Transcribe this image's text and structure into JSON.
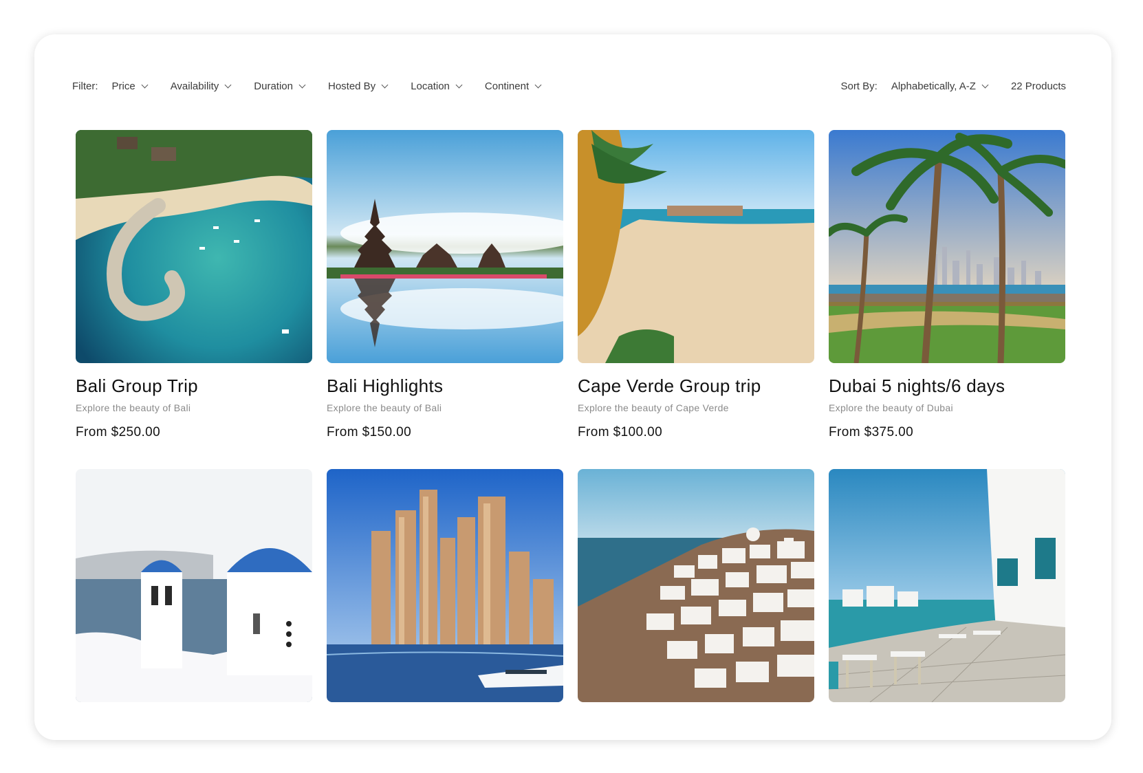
{
  "filter": {
    "label": "Filter:",
    "items": [
      "Price",
      "Availability",
      "Duration",
      "Hosted By",
      "Location",
      "Continent"
    ]
  },
  "sort": {
    "label": "Sort By:",
    "value": "Alphabetically, A-Z",
    "count": "22 Products"
  },
  "products": [
    {
      "title": "Bali Group Trip",
      "subtitle": "Explore the beauty of Bali",
      "price": "From $250.00",
      "image": "aerial-beach-lagoon"
    },
    {
      "title": "Bali Highlights",
      "subtitle": "Explore the beauty of Bali",
      "price": "From $150.00",
      "image": "temple-lake-reflection"
    },
    {
      "title": "Cape Verde Group trip",
      "subtitle": "Explore the beauty of Cape Verde",
      "price": "From $100.00",
      "image": "sandy-beach-palms"
    },
    {
      "title": "Dubai 5 nights/6 days",
      "subtitle": "Explore the beauty of Dubai",
      "price": "From $375.00",
      "image": "palm-trees-skyline"
    },
    {
      "title": "",
      "subtitle": "",
      "price": "",
      "image": "santorini-blue-domes"
    },
    {
      "title": "",
      "subtitle": "",
      "price": "",
      "image": "dubai-marina-skyscrapers"
    },
    {
      "title": "",
      "subtitle": "",
      "price": "",
      "image": "oia-whitewashed-village"
    },
    {
      "title": "",
      "subtitle": "",
      "price": "",
      "image": "seaside-cafe-terrace"
    }
  ]
}
